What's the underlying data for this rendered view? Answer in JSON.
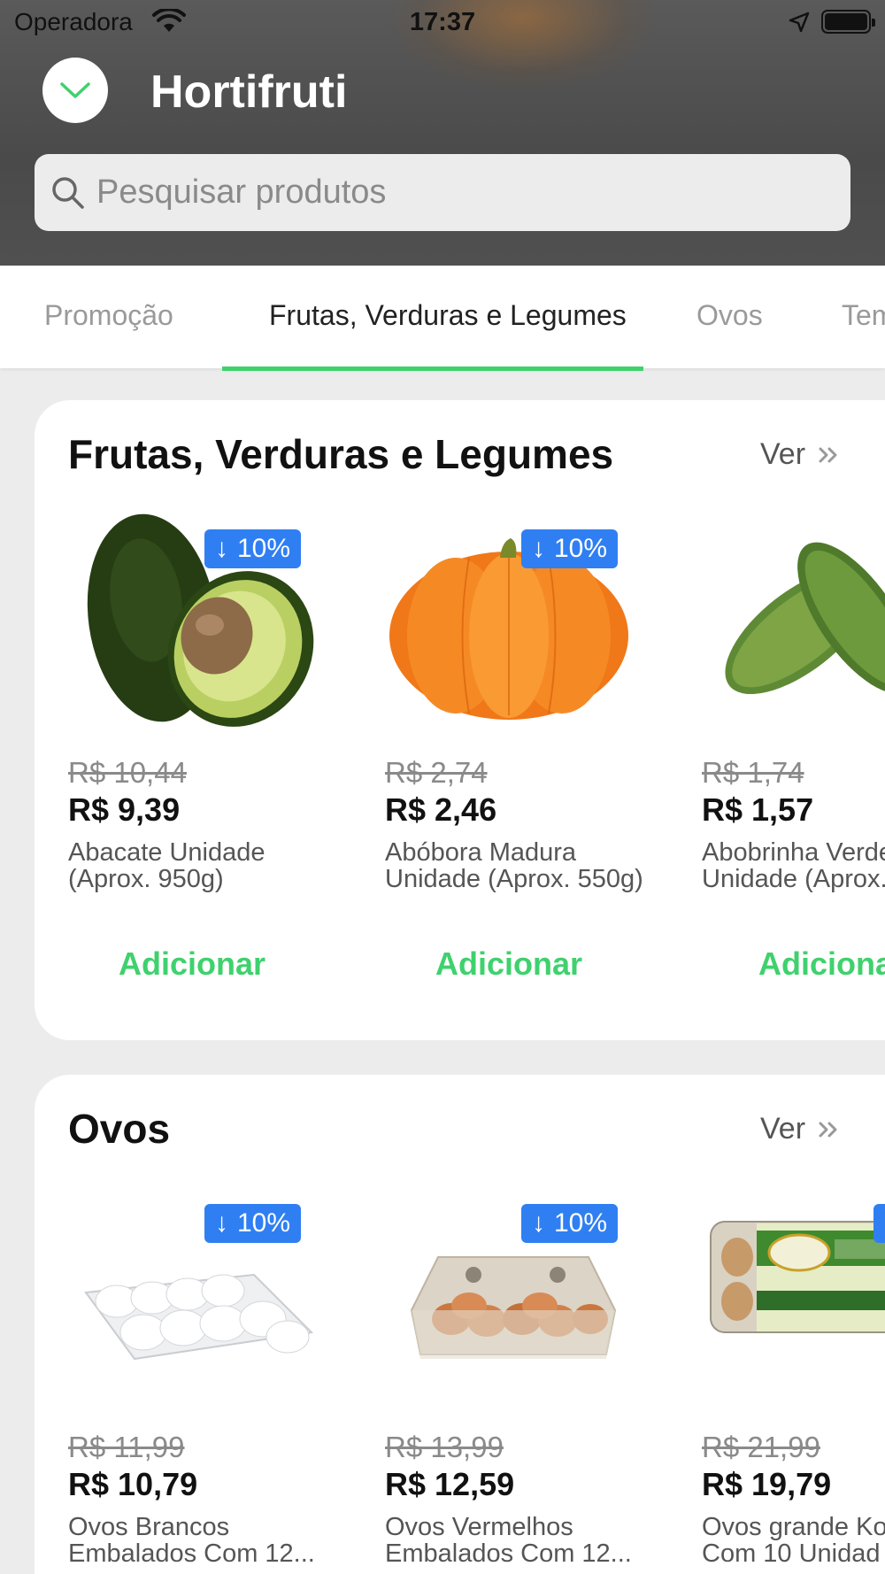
{
  "status_bar": {
    "carrier": "Operadora",
    "time": "17:37"
  },
  "header": {
    "title": "Hortifruti",
    "collapse_icon": "chevron-down-icon"
  },
  "search": {
    "placeholder": "Pesquisar produtos",
    "value": ""
  },
  "tabs": [
    {
      "label": "Promoção",
      "active": false
    },
    {
      "label": "Frutas, Verduras e Legumes",
      "active": true
    },
    {
      "label": "Ovos",
      "active": false
    },
    {
      "label": "Tem",
      "active": false
    }
  ],
  "accent_color": "#3fd16d",
  "badge_color": "#2f7ff2",
  "sections": [
    {
      "title": "Frutas, Verduras e Legumes",
      "see_all": "Ver",
      "products": [
        {
          "discount": "10%",
          "old_price": "R$ 10,44",
          "price": "R$ 9,39",
          "name_line1": "Abacate Unidade",
          "name_line2": "(Aprox. 950g)",
          "add_label": "Adicionar"
        },
        {
          "discount": "10%",
          "old_price": "R$ 2,74",
          "price": "R$ 2,46",
          "name_line1": "Abóbora Madura",
          "name_line2": "Unidade (Aprox. 550g)",
          "add_label": "Adicionar"
        },
        {
          "discount": "",
          "old_price": "R$ 1,74",
          "price": "R$ 1,57",
          "name_line1": "Abobrinha Verde",
          "name_line2": "Unidade (Aprox.",
          "add_label": "Adiciona"
        }
      ]
    },
    {
      "title": "Ovos",
      "see_all": "Ver",
      "products": [
        {
          "discount": "10%",
          "old_price": "R$ 11,99",
          "price": "R$ 10,79",
          "name_line1": "Ovos Brancos",
          "name_line2": "Embalados Com 12...",
          "add_label": ""
        },
        {
          "discount": "10%",
          "old_price": "R$ 13,99",
          "price": "R$ 12,59",
          "name_line1": "Ovos Vermelhos",
          "name_line2": "Embalados Com 12...",
          "add_label": ""
        },
        {
          "discount": "",
          "old_price": "R$ 21,99",
          "price": "R$ 19,79",
          "name_line1": "Ovos grande Ko",
          "name_line2": "Com 10 Unidad",
          "add_label": ""
        }
      ]
    }
  ]
}
